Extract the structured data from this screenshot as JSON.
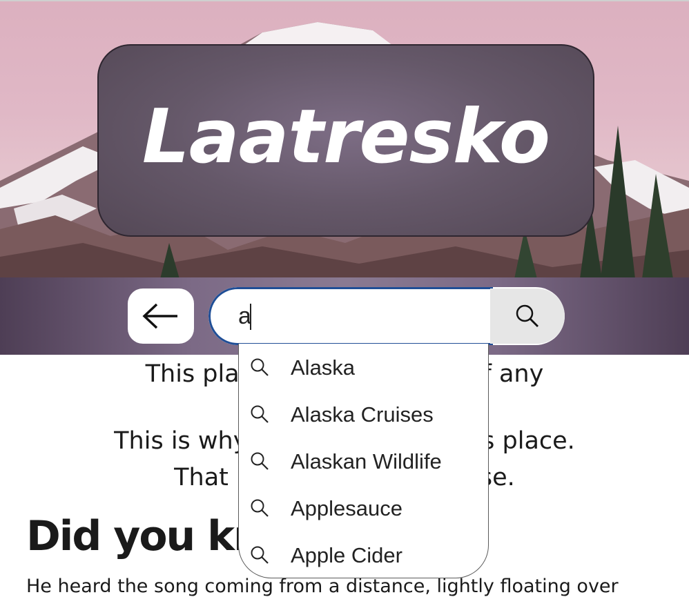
{
  "site": {
    "title": "Laatresko"
  },
  "search": {
    "value": "a",
    "back_icon": "arrow-left-icon",
    "submit_icon": "search-icon",
    "suggestions": [
      "Alaska",
      "Alaska Cruises",
      "Alaskan Wildlife",
      "Applesauce",
      "Apple Cider"
    ]
  },
  "content": {
    "line1_left": "This place",
    "line1_right": "e of any",
    "line2_left": "This is why",
    "line2_right": "is place.",
    "line3_left": "That",
    "line3_right": "se.",
    "heading": "Did you kno",
    "paragraph": "He heard the song coming from a distance, lightly floating over"
  },
  "colors": {
    "title_box": "#655869",
    "band": "#7c6a86",
    "input_border": "#1f4e96",
    "search_button": "#e6e6e6"
  }
}
